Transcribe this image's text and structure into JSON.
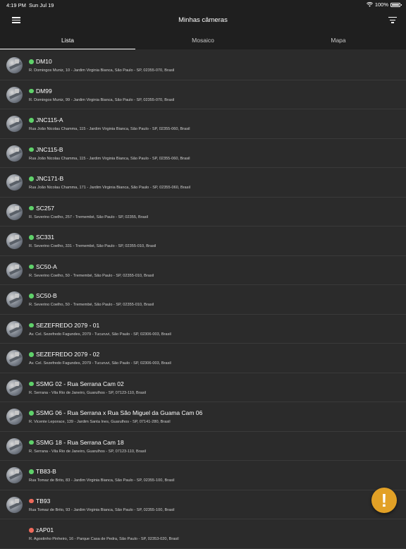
{
  "status_bar": {
    "time": "4:19 PM",
    "date": "Sun Jul 19",
    "battery": "100%",
    "wifi_icon": "wifi-icon"
  },
  "header": {
    "title": "Minhas câmeras",
    "menu_icon": "hamburger-menu-icon",
    "filter_icon": "filter-icon"
  },
  "tabs": [
    {
      "label": "Lista",
      "active": true
    },
    {
      "label": "Mosaico",
      "active": false
    },
    {
      "label": "Mapa",
      "active": false
    }
  ],
  "colors": {
    "online": "#5fd16a",
    "offline": "#ef6a5b",
    "alert_button": "#e2a126"
  },
  "cameras": [
    {
      "name": "DM10",
      "address": "R. Domingos Muniz, 10 - Jardim Virginia Bianca, São Paulo - SP, 02355-070, Brasil",
      "status": "online",
      "thumbnail": true
    },
    {
      "name": "DM99",
      "address": "R. Domingos Muniz, 99 - Jardim Virginia Bianca, São Paulo - SP, 02355-070, Brasil",
      "status": "online",
      "thumbnail": true
    },
    {
      "name": "JNC115-A",
      "address": "Rua João Nicolau Chamma, 115 - Jardim Virginia Bianca, São Paulo - SP, 02355-060, Brasil",
      "status": "online",
      "thumbnail": true
    },
    {
      "name": "JNC115-B",
      "address": "Rua João Nicolau Chamma, 115 - Jardim Virginia Bianca, São Paulo - SP, 02355-060, Brasil",
      "status": "online",
      "thumbnail": true
    },
    {
      "name": "JNC171-B",
      "address": "Rua João Nicolau Chamma, 171 - Jardim Virginia Bianca, São Paulo - SP, 02355-060, Brasil",
      "status": "online",
      "thumbnail": true
    },
    {
      "name": "SC257",
      "address": "R. Severino Coelho, 257 - Tremembé, São Paulo - SP, 02355, Brasil",
      "status": "online",
      "thumbnail": true
    },
    {
      "name": "SC331",
      "address": "R. Severino Coelho, 331 - Tremembé, São Paulo - SP, 02355-010, Brasil",
      "status": "online",
      "thumbnail": true
    },
    {
      "name": "SC50-A",
      "address": "R. Severino Coelho, 50 - Tremembé, São Paulo - SP, 02355-010, Brasil",
      "status": "online",
      "thumbnail": true
    },
    {
      "name": "SC50-B",
      "address": "R. Severino Coelho, 50 - Tremembé, São Paulo - SP, 02355-010, Brasil",
      "status": "online",
      "thumbnail": true
    },
    {
      "name": "SEZEFREDO 2079 - 01",
      "address": "Av. Cel. Sezefredo Fagundes, 2079 - Tucuruvi, São Paulo - SP, 02306-003, Brasil",
      "status": "online",
      "thumbnail": true
    },
    {
      "name": "SEZEFREDO 2079 - 02",
      "address": "Av. Cel. Sezefredo Fagundes, 2079 - Tucuruvi, São Paulo - SP, 02306-003, Brasil",
      "status": "online",
      "thumbnail": true
    },
    {
      "name": "SSMG 02 - Rua Serrana Cam 02",
      "address": "R. Serrana - Vila Rio de Janeiro, Guarulhos - SP, 07123-110, Brasil",
      "status": "online",
      "thumbnail": true
    },
    {
      "name": "SSMG 06 - Rua Serrana x Rua São Miguel da Guama Cam 06",
      "address": "R. Vicente Leporace, 139 - Jardim Santa Ines, Guarulhos - SP, 07141-280, Brasil",
      "status": "online",
      "thumbnail": true
    },
    {
      "name": "SSMG 18 - Rua Serrana Cam 18",
      "address": "R. Serrana - Vila Rio de Janeiro, Guarulhos - SP, 07123-110, Brasil",
      "status": "online",
      "thumbnail": true
    },
    {
      "name": "TB83-B",
      "address": "Rua Tomaz de Brito, 83 - Jardim Virginia Bianca, São Paulo - SP, 02355-100, Brasil",
      "status": "online",
      "thumbnail": true
    },
    {
      "name": "TB93",
      "address": "Rua Tomaz de Brito, 93 - Jardim Virginia Bianca, São Paulo - SP, 02355-100, Brasil",
      "status": "offline",
      "thumbnail": true
    },
    {
      "name": "zAP01",
      "address": "R. Agostinho Pinheiro, 16 - Parque Casa de Pedra, São Paulo - SP, 02353-020, Brasil",
      "status": "offline",
      "thumbnail": false
    }
  ],
  "alert_button": {
    "label": "!",
    "icon": "alert-icon"
  }
}
